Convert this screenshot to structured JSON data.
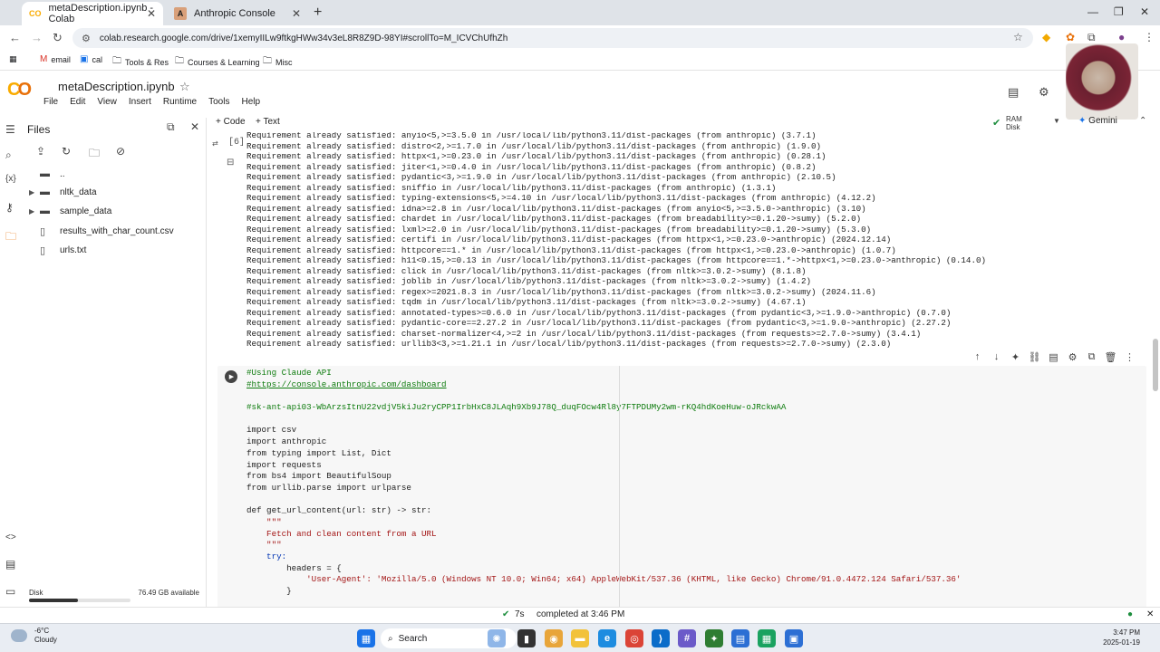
{
  "browser": {
    "tabs": [
      {
        "title": "metaDescription.ipynb - Colab",
        "active": true,
        "icon": "colab-icon"
      },
      {
        "title": "Anthropic Console",
        "active": false,
        "icon": "anthropic-icon"
      }
    ],
    "url": "colab.research.google.com/drive/1xemyIILw9ftkgHWw34v3eL8R8Z9D-98YI#scrollTo=M_ICVChUfhZh",
    "bookmarks": [
      {
        "label": "email",
        "icon": "gmail-icon"
      },
      {
        "label": "cal",
        "icon": "calendar-icon"
      },
      {
        "label": "Tools & Res",
        "icon": "folder-icon"
      },
      {
        "label": "Courses & Learning",
        "icon": "folder-icon"
      },
      {
        "label": "Misc",
        "icon": "folder-icon"
      }
    ]
  },
  "colab": {
    "notebook_title": "metaDescription.ipynb",
    "menu": [
      "File",
      "Edit",
      "View",
      "Insert",
      "Runtime",
      "Tools",
      "Help"
    ],
    "add_code": "+ Code",
    "add_text": "+ Text",
    "ram_label": "RAM",
    "disk_label": "Disk",
    "gemini": "Gemini",
    "accent_color": "#f9ab00"
  },
  "files_panel": {
    "title": "Files",
    "items": [
      {
        "name": "..",
        "type": "folder-up"
      },
      {
        "name": "nltk_data",
        "type": "folder"
      },
      {
        "name": "sample_data",
        "type": "folder"
      },
      {
        "name": "results_with_char_count.csv",
        "type": "file"
      },
      {
        "name": "urls.txt",
        "type": "file"
      }
    ],
    "disk_label": "Disk",
    "disk_available": "76.49 GB available",
    "disk_used_fraction": 0.48
  },
  "output_cell": {
    "execution_count": "[6]",
    "lines": [
      "Requirement already satisfied: anyio<5,>=3.5.0 in /usr/local/lib/python3.11/dist-packages (from anthropic) (3.7.1)",
      "Requirement already satisfied: distro<2,>=1.7.0 in /usr/local/lib/python3.11/dist-packages (from anthropic) (1.9.0)",
      "Requirement already satisfied: httpx<1,>=0.23.0 in /usr/local/lib/python3.11/dist-packages (from anthropic) (0.28.1)",
      "Requirement already satisfied: jiter<1,>=0.4.0 in /usr/local/lib/python3.11/dist-packages (from anthropic) (0.8.2)",
      "Requirement already satisfied: pydantic<3,>=1.9.0 in /usr/local/lib/python3.11/dist-packages (from anthropic) (2.10.5)",
      "Requirement already satisfied: sniffio in /usr/local/lib/python3.11/dist-packages (from anthropic) (1.3.1)",
      "Requirement already satisfied: typing-extensions<5,>=4.10 in /usr/local/lib/python3.11/dist-packages (from anthropic) (4.12.2)",
      "Requirement already satisfied: idna>=2.8 in /usr/local/lib/python3.11/dist-packages (from anyio<5,>=3.5.0->anthropic) (3.10)",
      "Requirement already satisfied: chardet in /usr/local/lib/python3.11/dist-packages (from breadability>=0.1.20->sumy) (5.2.0)",
      "Requirement already satisfied: lxml>=2.0 in /usr/local/lib/python3.11/dist-packages (from breadability>=0.1.20->sumy) (5.3.0)",
      "Requirement already satisfied: certifi in /usr/local/lib/python3.11/dist-packages (from httpx<1,>=0.23.0->anthropic) (2024.12.14)",
      "Requirement already satisfied: httpcore==1.* in /usr/local/lib/python3.11/dist-packages (from httpx<1,>=0.23.0->anthropic) (1.0.7)",
      "Requirement already satisfied: h11<0.15,>=0.13 in /usr/local/lib/python3.11/dist-packages (from httpcore==1.*->httpx<1,>=0.23.0->anthropic) (0.14.0)",
      "Requirement already satisfied: click in /usr/local/lib/python3.11/dist-packages (from nltk>=3.0.2->sumy) (8.1.8)",
      "Requirement already satisfied: joblib in /usr/local/lib/python3.11/dist-packages (from nltk>=3.0.2->sumy) (1.4.2)",
      "Requirement already satisfied: regex>=2021.8.3 in /usr/local/lib/python3.11/dist-packages (from nltk>=3.0.2->sumy) (2024.11.6)",
      "Requirement already satisfied: tqdm in /usr/local/lib/python3.11/dist-packages (from nltk>=3.0.2->sumy) (4.67.1)",
      "Requirement already satisfied: annotated-types>=0.6.0 in /usr/local/lib/python3.11/dist-packages (from pydantic<3,>=1.9.0->anthropic) (0.7.0)",
      "Requirement already satisfied: pydantic-core==2.27.2 in /usr/local/lib/python3.11/dist-packages (from pydantic<3,>=1.9.0->anthropic) (2.27.2)",
      "Requirement already satisfied: charset-normalizer<4,>=2 in /usr/local/lib/python3.11/dist-packages (from requests>=2.7.0->sumy) (3.4.1)",
      "Requirement already satisfied: urllib3<3,>=1.21.1 in /usr/local/lib/python3.11/dist-packages (from requests>=2.7.0->sumy) (2.3.0)"
    ]
  },
  "code_cell": {
    "lines": [
      {
        "text": "#Using Claude API",
        "kind": "cm"
      },
      {
        "text": "#https://console.anthropic.com/dashboard",
        "kind": "cm"
      },
      {
        "text": "",
        "kind": "blank"
      },
      {
        "text": "#sk-ant-api03-WbArzsItnU22vdjV5kiJu2ryCPP1IrbHxC8JLAqh9Xb9J78Q_duqFOcw4Rl8y7FTPDUMy2wm-rKQ4hdKoeHuw-oJRckwAA",
        "kind": "cm"
      },
      {
        "text": "",
        "kind": "blank"
      },
      {
        "text": "import csv",
        "kind": "import"
      },
      {
        "text": "import anthropic",
        "kind": "import"
      },
      {
        "text": "from typing import List, Dict",
        "kind": "from"
      },
      {
        "text": "import requests",
        "kind": "import"
      },
      {
        "text": "from bs4 import BeautifulSoup",
        "kind": "from"
      },
      {
        "text": "from urllib.parse import urlparse",
        "kind": "from"
      },
      {
        "text": "",
        "kind": "blank"
      },
      {
        "text": "def get_url_content(url: str) -> str:",
        "kind": "def"
      },
      {
        "text": "    \"\"\"",
        "kind": "st"
      },
      {
        "text": "    Fetch and clean content from a URL",
        "kind": "st"
      },
      {
        "text": "    \"\"\"",
        "kind": "st"
      },
      {
        "text": "    try:",
        "kind": "kw"
      },
      {
        "text": "        headers = {",
        "kind": "plain"
      },
      {
        "text": "            'User-Agent': 'Mozilla/5.0 (Windows NT 10.0; Win64; x64) AppleWebKit/537.36 (KHTML, like Gecko) Chrome/91.0.4472.124 Safari/537.36'",
        "kind": "st"
      },
      {
        "text": "        }",
        "kind": "plain"
      }
    ]
  },
  "status_bar": {
    "duration": "7s",
    "message": "completed at 3:46 PM"
  },
  "taskbar": {
    "temperature": "-6°C",
    "weather": "Cloudy",
    "search": "Search",
    "time": "3:47 PM",
    "date": "2025-01-19"
  }
}
